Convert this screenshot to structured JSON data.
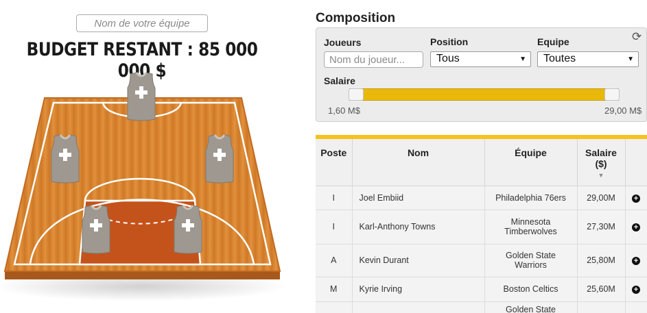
{
  "left": {
    "team_name_placeholder": "Nom de votre équipe",
    "budget_text": "BUDGET RESTANT : 85 000 000 $"
  },
  "composition": {
    "title": "Composition",
    "joueurs_label": "Joueurs",
    "player_placeholder": "Nom du joueur...",
    "position_label": "Position",
    "position_value": "Tous",
    "equipe_label": "Equipe",
    "equipe_value": "Toutes",
    "salaire_label": "Salaire",
    "salary_min_label": "1,60 M$",
    "salary_max_label": "29,00 M$",
    "salary_range_fraction": [
      0.0,
      1.0
    ]
  },
  "table": {
    "headers": {
      "poste": "Poste",
      "nom": "Nom",
      "equipe": "Équipe",
      "salaire": "Salaire",
      "salaire_unit": "($)"
    },
    "rows": [
      {
        "poste": "I",
        "nom": "Joel Embiid",
        "equipe": "Philadelphia 76ers",
        "salaire": "29,00M"
      },
      {
        "poste": "I",
        "nom": "Karl-Anthony Towns",
        "equipe": "Minnesota Timberwolves",
        "salaire": "27,30M"
      },
      {
        "poste": "A",
        "nom": "Kevin Durant",
        "equipe": "Golden State Warriors",
        "salaire": "25,80M"
      },
      {
        "poste": "M",
        "nom": "Kyrie Irving",
        "equipe": "Boston Celtics",
        "salaire": "25,60M"
      },
      {
        "poste": "",
        "nom": "",
        "equipe": "Golden State",
        "salaire": ""
      }
    ]
  },
  "colors": {
    "accent_yellow": "#f5c31a",
    "court_wood": "#d9822b",
    "court_paint": "#c4531b",
    "jersey_gray": "#9e9890"
  },
  "icons": {
    "refresh": "refresh-icon",
    "add": "plus-circle-icon",
    "sort": "sort-down-icon"
  }
}
